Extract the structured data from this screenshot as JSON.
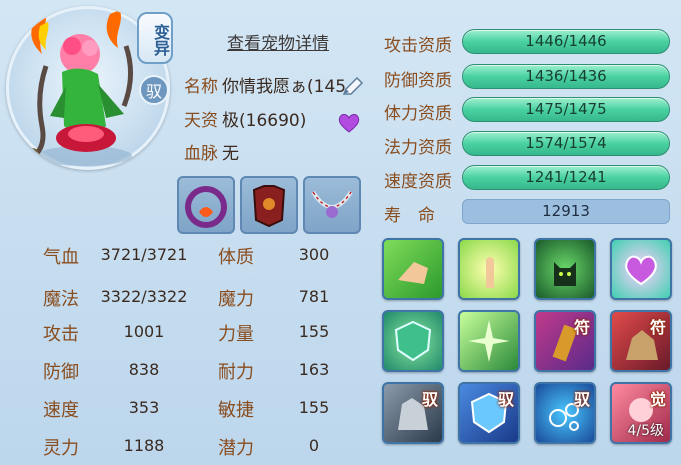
{
  "header": {
    "bianyi_badge": "变异",
    "yu_badge": "驭",
    "detail_link": "查看宠物详情"
  },
  "pet_info": {
    "name_label": "名称",
    "name_value": "你情我愿ぁ(145",
    "tianzi_label": "天资",
    "tianzi_value": "极(16690)",
    "xuemai_label": "血脉",
    "xuemai_value": "无"
  },
  "stats": [
    {
      "label": "气血",
      "value": "3721/3721"
    },
    {
      "label": "魔法",
      "value": "3322/3322"
    },
    {
      "label": "攻击",
      "value": "1001"
    },
    {
      "label": "防御",
      "value": "838"
    },
    {
      "label": "速度",
      "value": "353"
    },
    {
      "label": "灵力",
      "value": "1188"
    }
  ],
  "attributes": [
    {
      "label": "体质",
      "value": "300"
    },
    {
      "label": "魔力",
      "value": "781"
    },
    {
      "label": "力量",
      "value": "155"
    },
    {
      "label": "耐力",
      "value": "163"
    },
    {
      "label": "敏捷",
      "value": "155"
    },
    {
      "label": "潜力",
      "value": "0"
    }
  ],
  "aptitudes": [
    {
      "label": "攻击资质",
      "value": "1446/1446"
    },
    {
      "label": "防御资质",
      "value": "1436/1436"
    },
    {
      "label": "体力资质",
      "value": "1475/1475"
    },
    {
      "label": "法力资质",
      "value": "1574/1574"
    },
    {
      "label": "速度资质",
      "value": "1241/1241"
    }
  ],
  "life": {
    "label": "寿　命",
    "value": "12913"
  },
  "equipment": [
    {
      "icon": "collar-icon"
    },
    {
      "icon": "armor-icon"
    },
    {
      "icon": "necklace-icon"
    }
  ],
  "skills": {
    "tag_fu": "符",
    "tag_yu": "驭",
    "tag_jue": "觉",
    "level": "4/5级"
  },
  "colors": {
    "label_brown": "#8a4d1e",
    "aptitude_green": "#4ad1a2",
    "panel_blue": "#c6dcee"
  }
}
